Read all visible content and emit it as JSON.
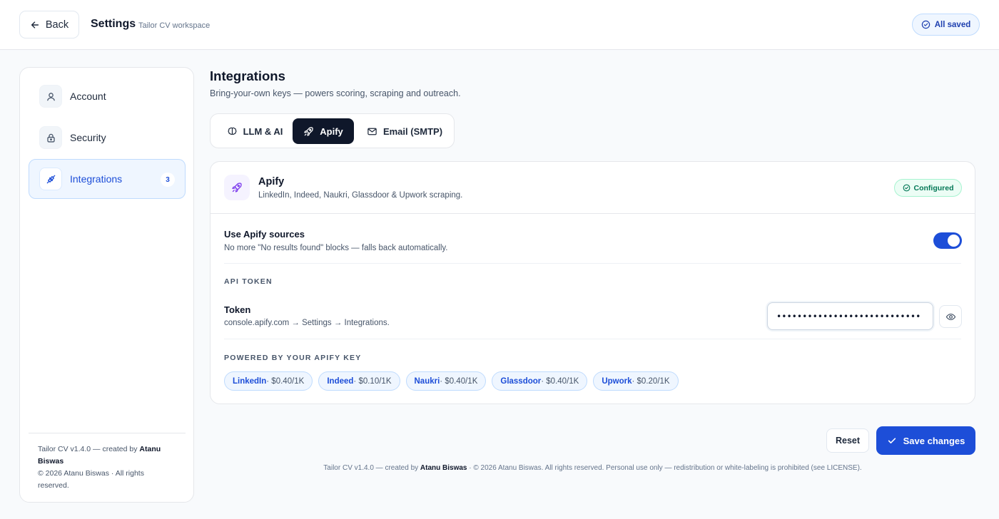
{
  "header": {
    "back_label": "Back",
    "title": "Settings",
    "subtitle": "Tailor CV workspace",
    "status": "All saved"
  },
  "sidebar": {
    "items": [
      {
        "label": "Account",
        "icon": "user-icon"
      },
      {
        "label": "Security",
        "icon": "lock-icon"
      },
      {
        "label": "Integrations",
        "icon": "plug-icon",
        "badge": "3",
        "active": true
      }
    ],
    "footer": {
      "prefix": "Tailor CV v1.4.0 — created by ",
      "author": "Atanu Biswas",
      "rights": "© 2026 Atanu Biswas · All rights reserved."
    }
  },
  "main": {
    "title": "Integrations",
    "subtitle": "Bring-your-own keys — powers scoring, scraping and outreach.",
    "tabs": [
      {
        "label": "LLM & AI",
        "icon": "brain-icon"
      },
      {
        "label": "Apify",
        "icon": "rocket-icon",
        "active": true
      },
      {
        "label": "Email (SMTP)",
        "icon": "mail-icon"
      }
    ]
  },
  "card": {
    "title": "Apify",
    "description": "LinkedIn, Indeed, Naukri, Glassdoor & Upwork scraping.",
    "status": "Configured",
    "toggle": {
      "label": "Use Apify sources",
      "description": "No more \"No results found\" blocks — falls back automatically.",
      "enabled": true
    },
    "api_section": "API TOKEN",
    "token": {
      "label": "Token",
      "description": "console.apify.com → Settings → Integrations.",
      "value": "••••••••••••••••••••••••••••"
    },
    "powered_section": "POWERED BY YOUR APIFY KEY",
    "sources": [
      {
        "name": "LinkedIn",
        "price": " · $0.40/1K"
      },
      {
        "name": "Indeed",
        "price": " · $0.10/1K"
      },
      {
        "name": "Naukri",
        "price": " · $0.40/1K"
      },
      {
        "name": "Glassdoor",
        "price": " · $0.40/1K"
      },
      {
        "name": "Upwork",
        "price": " · $0.20/1K"
      }
    ]
  },
  "actions": {
    "reset_label": "Reset",
    "save_label": "Save changes"
  },
  "footer": {
    "prefix": "Tailor CV v1.4.0 — created by ",
    "author": "Atanu Biswas",
    "suffix": " · © 2026 Atanu Biswas. All rights reserved. Personal use only — redistribution or white-labeling is prohibited (see LICENSE)."
  },
  "colors": {
    "accent": "#1d4ed8",
    "dark": "#0f172a",
    "success": "#047857"
  }
}
